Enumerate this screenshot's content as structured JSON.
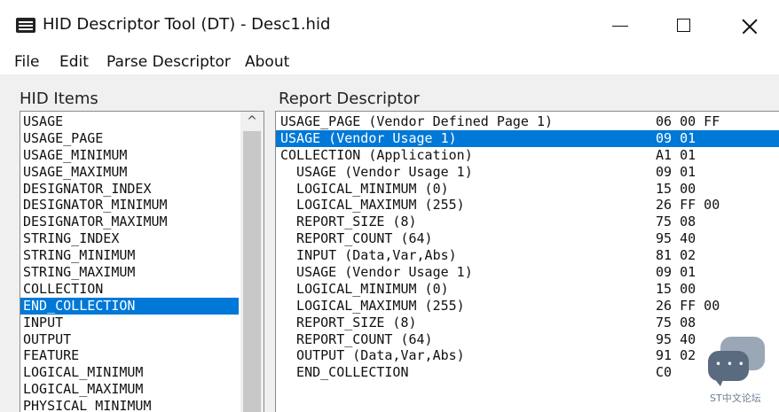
{
  "window": {
    "title": "HID Descriptor Tool (DT) - Desc1.hid",
    "app_icon": "dt-app-icon",
    "controls": {
      "minimize": "minimize",
      "maximize": "maximize",
      "close": "close"
    }
  },
  "menu": [
    "File",
    "Edit",
    "Parse Descriptor",
    "About"
  ],
  "hid_items": {
    "label": "HID Items",
    "items": [
      "USAGE",
      "USAGE_PAGE",
      "USAGE_MINIMUM",
      "USAGE_MAXIMUM",
      "DESIGNATOR_INDEX",
      "DESIGNATOR_MINIMUM",
      "DESIGNATOR_MAXIMUM",
      "STRING_INDEX",
      "STRING_MINIMUM",
      "STRING_MAXIMUM",
      "COLLECTION",
      "END_COLLECTION",
      "INPUT",
      "OUTPUT",
      "FEATURE",
      "LOGICAL_MINIMUM",
      "LOGICAL_MAXIMUM",
      "PHYSICAL_MINIMUM"
    ],
    "selected_index": 11
  },
  "report_descriptor": {
    "label": "Report Descriptor",
    "rows": [
      {
        "text": "USAGE_PAGE (Vendor Defined Page 1)",
        "hex": "06 00 FF"
      },
      {
        "text": "USAGE (Vendor Usage 1)",
        "hex": "09 01"
      },
      {
        "text": "COLLECTION (Application)",
        "hex": "A1 01"
      },
      {
        "text": "  USAGE (Vendor Usage 1)",
        "hex": "09 01"
      },
      {
        "text": "  LOGICAL_MINIMUM (0)",
        "hex": "15 00"
      },
      {
        "text": "  LOGICAL_MAXIMUM (255)",
        "hex": "26 FF 00"
      },
      {
        "text": "  REPORT_SIZE (8)",
        "hex": "75 08"
      },
      {
        "text": "  REPORT_COUNT (64)",
        "hex": "95 40"
      },
      {
        "text": "  INPUT (Data,Var,Abs)",
        "hex": "81 02"
      },
      {
        "text": "  USAGE (Vendor Usage 1)",
        "hex": "09 01"
      },
      {
        "text": "  LOGICAL_MINIMUM (0)",
        "hex": "15 00"
      },
      {
        "text": "  LOGICAL_MAXIMUM (255)",
        "hex": "26 FF 00"
      },
      {
        "text": "  REPORT_SIZE (8)",
        "hex": "75 08"
      },
      {
        "text": "  REPORT_COUNT (64)",
        "hex": "95 40"
      },
      {
        "text": "  OUTPUT (Data,Var,Abs)",
        "hex": "91 02"
      },
      {
        "text": "  END_COLLECTION",
        "hex": "C0"
      }
    ],
    "selected_index": 1
  },
  "watermark": {
    "text": "ST中文论坛",
    "icon": "chat-bubbles-icon"
  },
  "colors": {
    "selection": "#0078d7",
    "background": "#f0f0f0"
  }
}
